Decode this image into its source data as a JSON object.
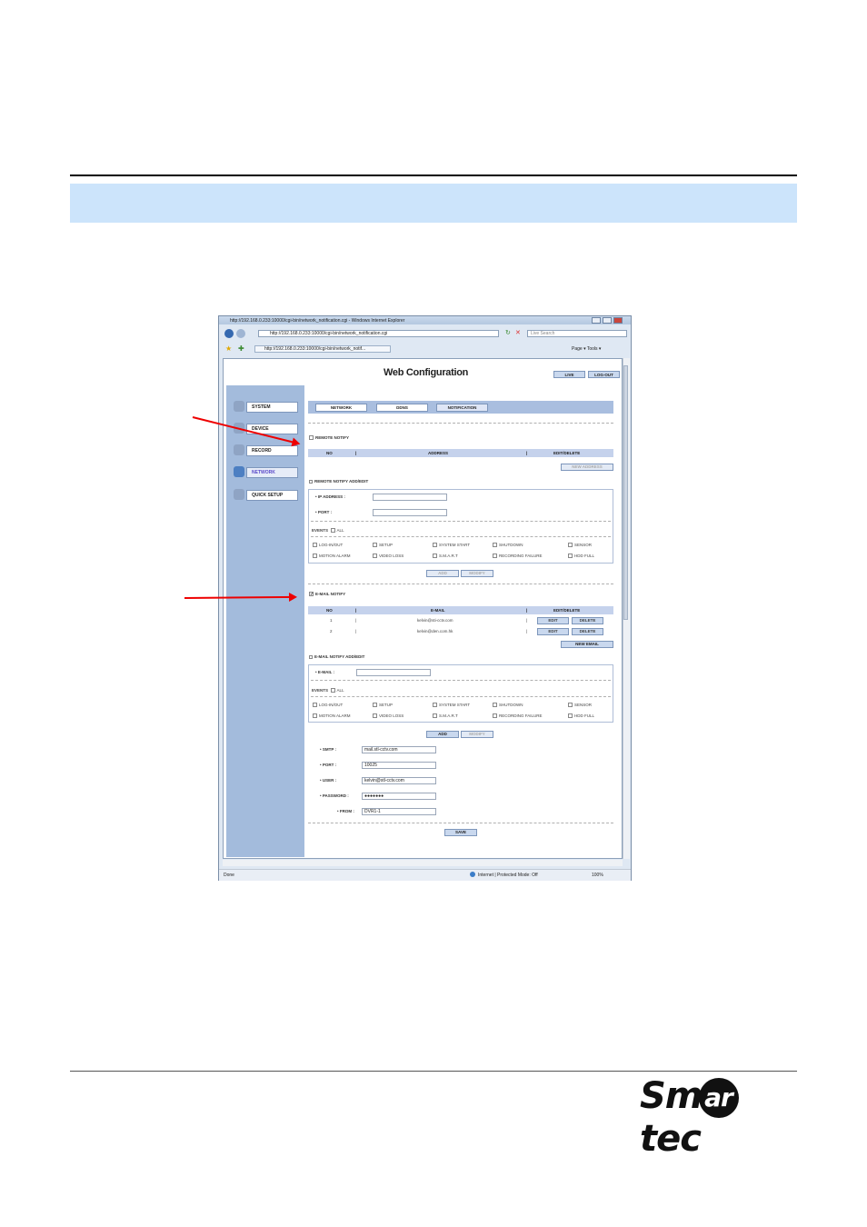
{
  "browser": {
    "title": "http://192.168.0.233:10000/cgi-bin/network_notification.cgi - Windows Internet Explorer",
    "url": "http://192.168.0.233:10000/cgi-bin/network_notification.cgi",
    "search_placeholder": "Live Search",
    "tab": "http://192.168.0.233:10000/cgi-bin/network_notif...",
    "tools": "Page ▾  Tools ▾",
    "status_left": "Done",
    "status_zone": "Internet | Protected Mode: Off",
    "zoom": "100%"
  },
  "app": {
    "title": "Web Configuration",
    "live": "LIVE",
    "logout": "LOG-OUT"
  },
  "sidebar": {
    "items": [
      "SYSTEM",
      "DEVICE",
      "RECORD",
      "NETWORK",
      "QUICK SETUP"
    ]
  },
  "tabs": [
    "NETWORK",
    "DDNS",
    "NOTIFICATION"
  ],
  "remote": {
    "notify": "REMOTE NOTIFY",
    "col_no": "NO",
    "col_address": "ADDRESS",
    "col_edit": "EDIT/DELETE",
    "new_address": "NEW ADDRESS",
    "section": "REMOTE NOTIFY ADD/EDIT",
    "ip_label": "IP ADDRESS :",
    "port_label": "PORT :",
    "add": "ADD",
    "modify": "MODIFY"
  },
  "events": {
    "label": "EVENTS",
    "all": "ALL",
    "row1": [
      "LOG-IN/OUT",
      "SETUP",
      "SYSTEM START",
      "SHUTDOWN",
      "SENSOR"
    ],
    "row2": [
      "MOTION ALARM",
      "VIDEO LOSS",
      "S.M.A.R.T",
      "RECORDING FAILURE",
      "HDD FULL"
    ]
  },
  "email": {
    "notify": "E-MAIL NOTIFY",
    "col_no": "NO",
    "col_email": "E-MAIL",
    "col_edit": "EDIT/DELETE",
    "rows": [
      {
        "no": "1",
        "email": "kelvin@sti-cctv.com",
        "edit": "EDIT",
        "delete": "DELETE"
      },
      {
        "no": "2",
        "email": "kelvin@den.com.hk",
        "edit": "EDIT",
        "delete": "DELETE"
      }
    ],
    "new_email": "NEW EMAIL",
    "section": "E-MAIL NOTIFY ADD/EDIT",
    "email_label": "E-MAIL :",
    "add": "ADD",
    "modify": "MODIFY"
  },
  "smtp": {
    "smtp_label": "SMTP :",
    "smtp_value": "mail.stl-cctv.com",
    "port_label": "PORT :",
    "port_value": "10025",
    "user_label": "USER :",
    "user_value": "kelvin@stl-cctv.com",
    "password_label": "PASSWORD :",
    "password_value": "●●●●●●●",
    "from_label": "FROM :",
    "from_value": "DVR1-1",
    "save": "SAVE"
  },
  "logo": {
    "text_left": "Sm",
    "text_ball": "ar",
    "text_right": "tec"
  }
}
